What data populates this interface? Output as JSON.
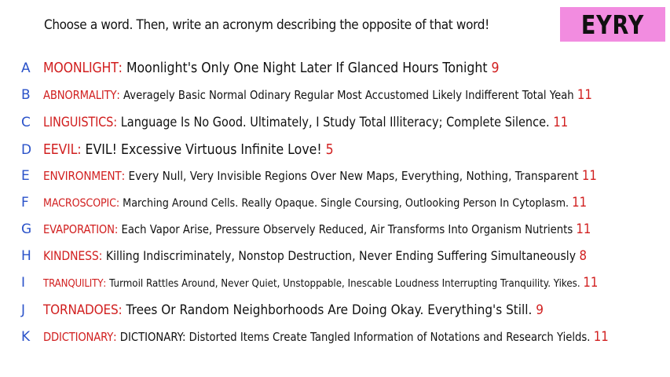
{
  "prompt": "Choose a word. Then, write an acronym describing the opposite of that word!",
  "badge": {
    "text": "EYRY",
    "color": "#f28ce0"
  },
  "colors": {
    "letter": "#2a52c9",
    "word": "#d11f1f",
    "count": "#d11f1f",
    "text": "#111111"
  },
  "entries": [
    {
      "letter": "A",
      "word": "MOONLIGHT",
      "definition": "Moonlight's Only One Night Later If Glanced Hours Tonight",
      "count": "9"
    },
    {
      "letter": "B",
      "word": "ABNORMALITY",
      "definition": "Averagely Basic Normal Odinary Regular Most Accustomed Likely Indifferent Total Yeah",
      "count": "11"
    },
    {
      "letter": "C",
      "word": "LINGUISTICS",
      "definition": "Language Is No Good. Ultimately, I Study Total Illiteracy; Complete Silence.",
      "count": "11"
    },
    {
      "letter": "D",
      "word": "EEVIL",
      "definition": "EVIL! Excessive Virtuous Infinite Love!",
      "count": "5"
    },
    {
      "letter": "E",
      "word": "ENVIRONMENT",
      "definition": "Every Null, Very Invisible Regions Over New Maps, Everything, Nothing, Transparent",
      "count": "11"
    },
    {
      "letter": "F",
      "word": "MACROSCOPIC",
      "definition": "Marching Around Cells. Really Opaque. Single Coursing, Outlooking Person In Cytoplasm.",
      "count": "11"
    },
    {
      "letter": "G",
      "word": "EVAPORATION",
      "definition": "Each Vapor Arise, Pressure Observely Reduced, Air Transforms Into Organism Nutrients",
      "count": "11"
    },
    {
      "letter": "H",
      "word": "KINDNESS",
      "definition": "Killing Indiscriminately, Nonstop Destruction, Never Ending Suffering Simultaneously",
      "count": "8"
    },
    {
      "letter": "I",
      "word": "TRANQUILITY",
      "definition": "Turmoil Rattles Around, Never Quiet, Unstoppable, Inescable Loudness Interrupting Tranquility. Yikes.",
      "count": "11"
    },
    {
      "letter": "J",
      "word": "TORNADOES",
      "definition": "Trees Or Random Neighborhoods Are Doing Okay. Everything's Still.",
      "count": "9"
    },
    {
      "letter": "K",
      "word": "DDICTIONARY",
      "definition": "DICTIONARY: Distorted Items Create Tangled Information of Notations and Research Yields.",
      "count": "11"
    }
  ]
}
